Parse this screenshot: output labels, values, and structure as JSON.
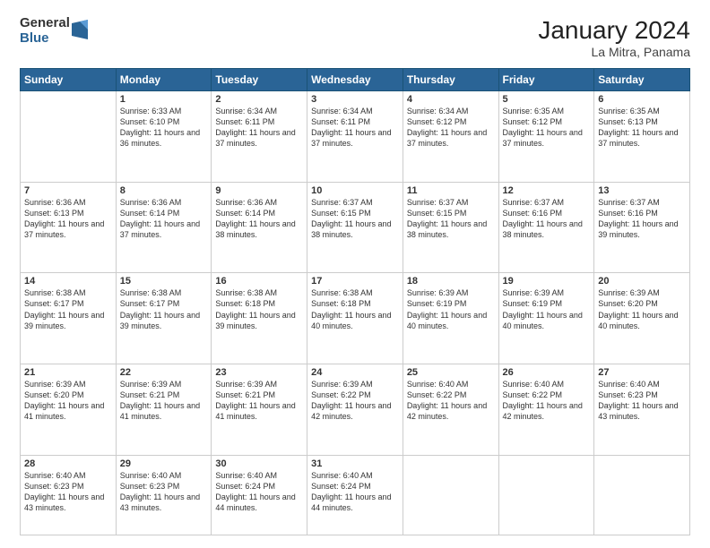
{
  "logo": {
    "line1": "General",
    "line2": "Blue"
  },
  "title": "January 2024",
  "subtitle": "La Mitra, Panama",
  "days_of_week": [
    "Sunday",
    "Monday",
    "Tuesday",
    "Wednesday",
    "Thursday",
    "Friday",
    "Saturday"
  ],
  "weeks": [
    [
      {
        "num": "",
        "empty": true
      },
      {
        "num": "1",
        "sunrise": "6:33 AM",
        "sunset": "6:10 PM",
        "daylight": "11 hours and 36 minutes."
      },
      {
        "num": "2",
        "sunrise": "6:34 AM",
        "sunset": "6:11 PM",
        "daylight": "11 hours and 37 minutes."
      },
      {
        "num": "3",
        "sunrise": "6:34 AM",
        "sunset": "6:11 PM",
        "daylight": "11 hours and 37 minutes."
      },
      {
        "num": "4",
        "sunrise": "6:34 AM",
        "sunset": "6:12 PM",
        "daylight": "11 hours and 37 minutes."
      },
      {
        "num": "5",
        "sunrise": "6:35 AM",
        "sunset": "6:12 PM",
        "daylight": "11 hours and 37 minutes."
      },
      {
        "num": "6",
        "sunrise": "6:35 AM",
        "sunset": "6:13 PM",
        "daylight": "11 hours and 37 minutes."
      }
    ],
    [
      {
        "num": "7",
        "sunrise": "6:36 AM",
        "sunset": "6:13 PM",
        "daylight": "11 hours and 37 minutes."
      },
      {
        "num": "8",
        "sunrise": "6:36 AM",
        "sunset": "6:14 PM",
        "daylight": "11 hours and 37 minutes."
      },
      {
        "num": "9",
        "sunrise": "6:36 AM",
        "sunset": "6:14 PM",
        "daylight": "11 hours and 38 minutes."
      },
      {
        "num": "10",
        "sunrise": "6:37 AM",
        "sunset": "6:15 PM",
        "daylight": "11 hours and 38 minutes."
      },
      {
        "num": "11",
        "sunrise": "6:37 AM",
        "sunset": "6:15 PM",
        "daylight": "11 hours and 38 minutes."
      },
      {
        "num": "12",
        "sunrise": "6:37 AM",
        "sunset": "6:16 PM",
        "daylight": "11 hours and 38 minutes."
      },
      {
        "num": "13",
        "sunrise": "6:37 AM",
        "sunset": "6:16 PM",
        "daylight": "11 hours and 39 minutes."
      }
    ],
    [
      {
        "num": "14",
        "sunrise": "6:38 AM",
        "sunset": "6:17 PM",
        "daylight": "11 hours and 39 minutes."
      },
      {
        "num": "15",
        "sunrise": "6:38 AM",
        "sunset": "6:17 PM",
        "daylight": "11 hours and 39 minutes."
      },
      {
        "num": "16",
        "sunrise": "6:38 AM",
        "sunset": "6:18 PM",
        "daylight": "11 hours and 39 minutes."
      },
      {
        "num": "17",
        "sunrise": "6:38 AM",
        "sunset": "6:18 PM",
        "daylight": "11 hours and 40 minutes."
      },
      {
        "num": "18",
        "sunrise": "6:39 AM",
        "sunset": "6:19 PM",
        "daylight": "11 hours and 40 minutes."
      },
      {
        "num": "19",
        "sunrise": "6:39 AM",
        "sunset": "6:19 PM",
        "daylight": "11 hours and 40 minutes."
      },
      {
        "num": "20",
        "sunrise": "6:39 AM",
        "sunset": "6:20 PM",
        "daylight": "11 hours and 40 minutes."
      }
    ],
    [
      {
        "num": "21",
        "sunrise": "6:39 AM",
        "sunset": "6:20 PM",
        "daylight": "11 hours and 41 minutes."
      },
      {
        "num": "22",
        "sunrise": "6:39 AM",
        "sunset": "6:21 PM",
        "daylight": "11 hours and 41 minutes."
      },
      {
        "num": "23",
        "sunrise": "6:39 AM",
        "sunset": "6:21 PM",
        "daylight": "11 hours and 41 minutes."
      },
      {
        "num": "24",
        "sunrise": "6:39 AM",
        "sunset": "6:22 PM",
        "daylight": "11 hours and 42 minutes."
      },
      {
        "num": "25",
        "sunrise": "6:40 AM",
        "sunset": "6:22 PM",
        "daylight": "11 hours and 42 minutes."
      },
      {
        "num": "26",
        "sunrise": "6:40 AM",
        "sunset": "6:22 PM",
        "daylight": "11 hours and 42 minutes."
      },
      {
        "num": "27",
        "sunrise": "6:40 AM",
        "sunset": "6:23 PM",
        "daylight": "11 hours and 43 minutes."
      }
    ],
    [
      {
        "num": "28",
        "sunrise": "6:40 AM",
        "sunset": "6:23 PM",
        "daylight": "11 hours and 43 minutes."
      },
      {
        "num": "29",
        "sunrise": "6:40 AM",
        "sunset": "6:23 PM",
        "daylight": "11 hours and 43 minutes."
      },
      {
        "num": "30",
        "sunrise": "6:40 AM",
        "sunset": "6:24 PM",
        "daylight": "11 hours and 44 minutes."
      },
      {
        "num": "31",
        "sunrise": "6:40 AM",
        "sunset": "6:24 PM",
        "daylight": "11 hours and 44 minutes."
      },
      {
        "num": "",
        "empty": true
      },
      {
        "num": "",
        "empty": true
      },
      {
        "num": "",
        "empty": true
      }
    ]
  ]
}
